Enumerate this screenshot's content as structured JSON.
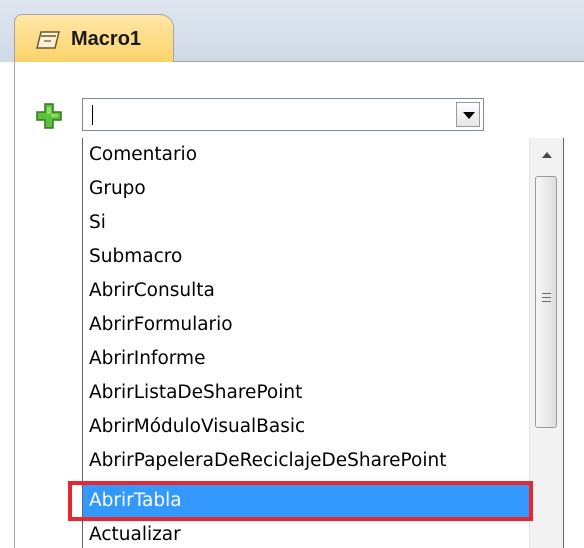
{
  "tab": {
    "label": "Macro1",
    "icon": "macro-icon"
  },
  "add_action": {
    "icon": "green-plus-icon"
  },
  "combo": {
    "value": "",
    "button_icon": "chevron-down-icon"
  },
  "dropdown": {
    "items": [
      "Comentario",
      "Grupo",
      "Si",
      "Submacro",
      "AbrirConsulta",
      "AbrirFormulario",
      "AbrirInforme",
      "AbrirListaDeSharePoint",
      "AbrirMóduloVisualBasic",
      "AbrirPapeleraDeReciclajeDeSharePoint",
      "AbrirTabla",
      "Actualizar"
    ],
    "selected_index": 10,
    "selected_item": "AbrirTabla"
  },
  "colors": {
    "selection": "#3399ff",
    "highlight_border": "#e8262f",
    "tab_fill": "#fbd36a"
  }
}
